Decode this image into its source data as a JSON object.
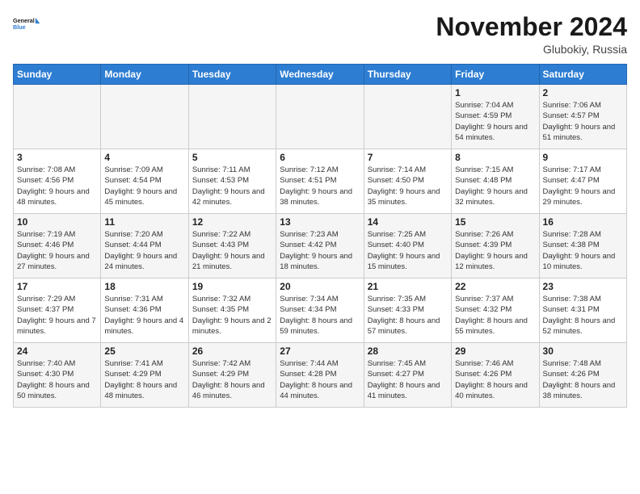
{
  "logo": {
    "line1": "General",
    "line2": "Blue"
  },
  "title": "November 2024",
  "location": "Glubokiy, Russia",
  "weekdays": [
    "Sunday",
    "Monday",
    "Tuesday",
    "Wednesday",
    "Thursday",
    "Friday",
    "Saturday"
  ],
  "weeks": [
    [
      {
        "day": "",
        "info": ""
      },
      {
        "day": "",
        "info": ""
      },
      {
        "day": "",
        "info": ""
      },
      {
        "day": "",
        "info": ""
      },
      {
        "day": "",
        "info": ""
      },
      {
        "day": "1",
        "info": "Sunrise: 7:04 AM\nSunset: 4:59 PM\nDaylight: 9 hours and 54 minutes."
      },
      {
        "day": "2",
        "info": "Sunrise: 7:06 AM\nSunset: 4:57 PM\nDaylight: 9 hours and 51 minutes."
      }
    ],
    [
      {
        "day": "3",
        "info": "Sunrise: 7:08 AM\nSunset: 4:56 PM\nDaylight: 9 hours and 48 minutes."
      },
      {
        "day": "4",
        "info": "Sunrise: 7:09 AM\nSunset: 4:54 PM\nDaylight: 9 hours and 45 minutes."
      },
      {
        "day": "5",
        "info": "Sunrise: 7:11 AM\nSunset: 4:53 PM\nDaylight: 9 hours and 42 minutes."
      },
      {
        "day": "6",
        "info": "Sunrise: 7:12 AM\nSunset: 4:51 PM\nDaylight: 9 hours and 38 minutes."
      },
      {
        "day": "7",
        "info": "Sunrise: 7:14 AM\nSunset: 4:50 PM\nDaylight: 9 hours and 35 minutes."
      },
      {
        "day": "8",
        "info": "Sunrise: 7:15 AM\nSunset: 4:48 PM\nDaylight: 9 hours and 32 minutes."
      },
      {
        "day": "9",
        "info": "Sunrise: 7:17 AM\nSunset: 4:47 PM\nDaylight: 9 hours and 29 minutes."
      }
    ],
    [
      {
        "day": "10",
        "info": "Sunrise: 7:19 AM\nSunset: 4:46 PM\nDaylight: 9 hours and 27 minutes."
      },
      {
        "day": "11",
        "info": "Sunrise: 7:20 AM\nSunset: 4:44 PM\nDaylight: 9 hours and 24 minutes."
      },
      {
        "day": "12",
        "info": "Sunrise: 7:22 AM\nSunset: 4:43 PM\nDaylight: 9 hours and 21 minutes."
      },
      {
        "day": "13",
        "info": "Sunrise: 7:23 AM\nSunset: 4:42 PM\nDaylight: 9 hours and 18 minutes."
      },
      {
        "day": "14",
        "info": "Sunrise: 7:25 AM\nSunset: 4:40 PM\nDaylight: 9 hours and 15 minutes."
      },
      {
        "day": "15",
        "info": "Sunrise: 7:26 AM\nSunset: 4:39 PM\nDaylight: 9 hours and 12 minutes."
      },
      {
        "day": "16",
        "info": "Sunrise: 7:28 AM\nSunset: 4:38 PM\nDaylight: 9 hours and 10 minutes."
      }
    ],
    [
      {
        "day": "17",
        "info": "Sunrise: 7:29 AM\nSunset: 4:37 PM\nDaylight: 9 hours and 7 minutes."
      },
      {
        "day": "18",
        "info": "Sunrise: 7:31 AM\nSunset: 4:36 PM\nDaylight: 9 hours and 4 minutes."
      },
      {
        "day": "19",
        "info": "Sunrise: 7:32 AM\nSunset: 4:35 PM\nDaylight: 9 hours and 2 minutes."
      },
      {
        "day": "20",
        "info": "Sunrise: 7:34 AM\nSunset: 4:34 PM\nDaylight: 8 hours and 59 minutes."
      },
      {
        "day": "21",
        "info": "Sunrise: 7:35 AM\nSunset: 4:33 PM\nDaylight: 8 hours and 57 minutes."
      },
      {
        "day": "22",
        "info": "Sunrise: 7:37 AM\nSunset: 4:32 PM\nDaylight: 8 hours and 55 minutes."
      },
      {
        "day": "23",
        "info": "Sunrise: 7:38 AM\nSunset: 4:31 PM\nDaylight: 8 hours and 52 minutes."
      }
    ],
    [
      {
        "day": "24",
        "info": "Sunrise: 7:40 AM\nSunset: 4:30 PM\nDaylight: 8 hours and 50 minutes."
      },
      {
        "day": "25",
        "info": "Sunrise: 7:41 AM\nSunset: 4:29 PM\nDaylight: 8 hours and 48 minutes."
      },
      {
        "day": "26",
        "info": "Sunrise: 7:42 AM\nSunset: 4:29 PM\nDaylight: 8 hours and 46 minutes."
      },
      {
        "day": "27",
        "info": "Sunrise: 7:44 AM\nSunset: 4:28 PM\nDaylight: 8 hours and 44 minutes."
      },
      {
        "day": "28",
        "info": "Sunrise: 7:45 AM\nSunset: 4:27 PM\nDaylight: 8 hours and 41 minutes."
      },
      {
        "day": "29",
        "info": "Sunrise: 7:46 AM\nSunset: 4:26 PM\nDaylight: 8 hours and 40 minutes."
      },
      {
        "day": "30",
        "info": "Sunrise: 7:48 AM\nSunset: 4:26 PM\nDaylight: 8 hours and 38 minutes."
      }
    ]
  ]
}
